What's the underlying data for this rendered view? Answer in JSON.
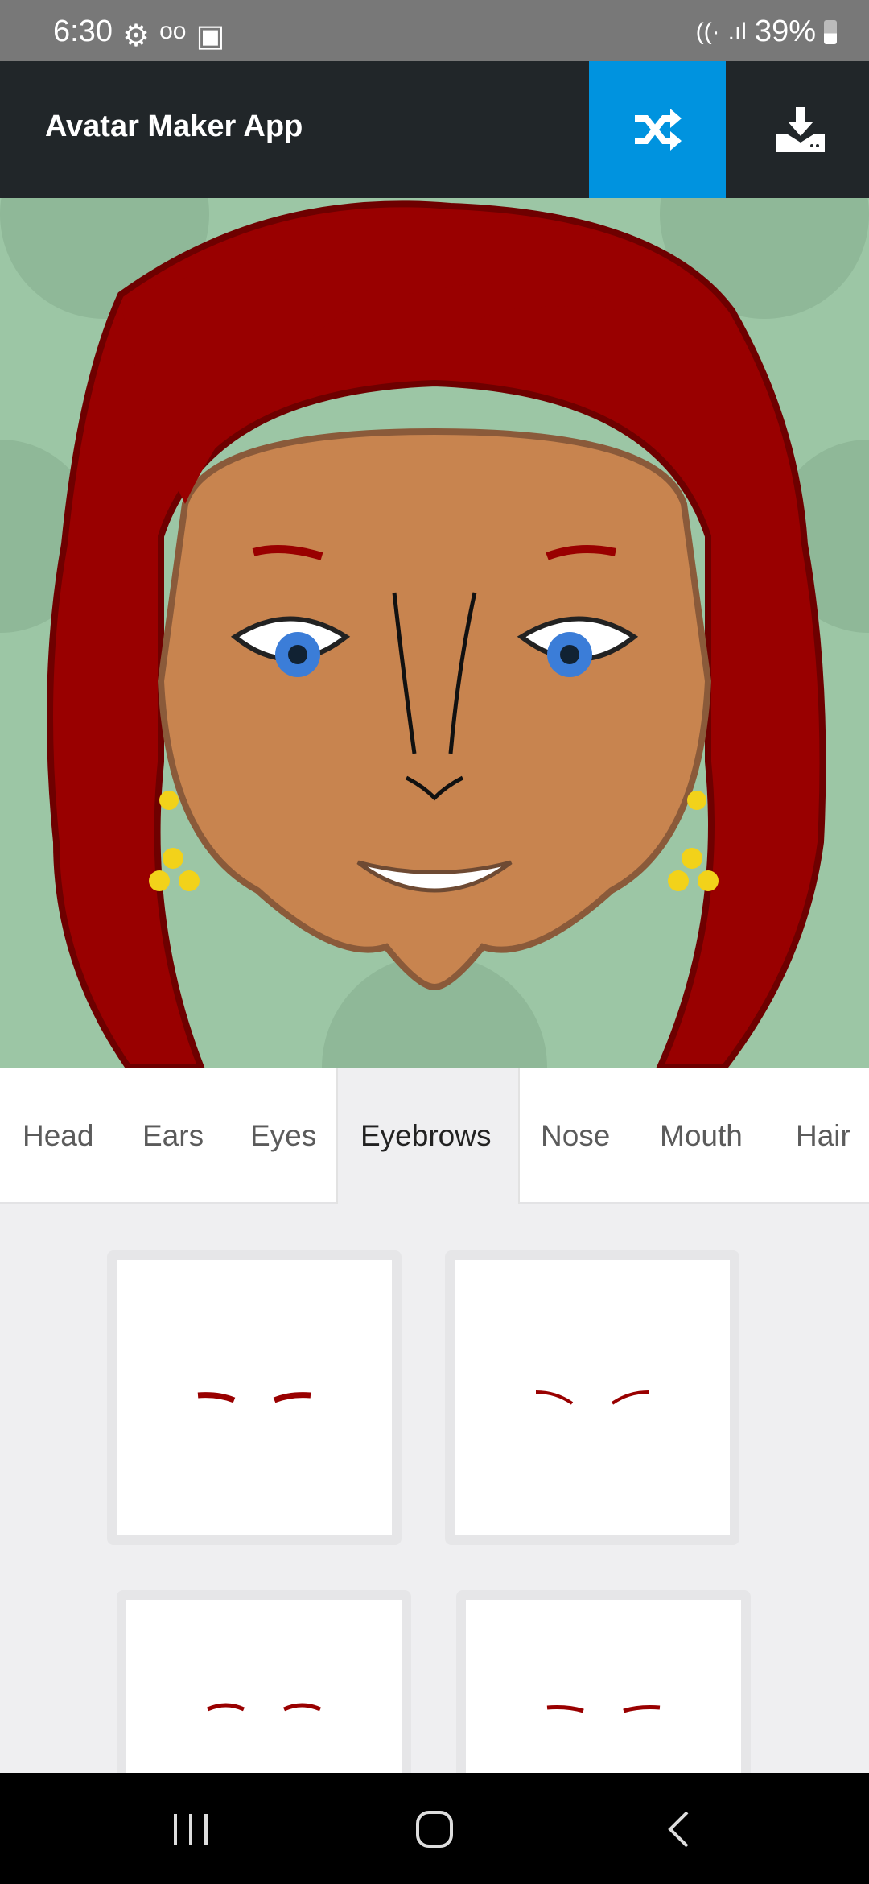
{
  "status_bar": {
    "time": "6:30",
    "battery": "39%"
  },
  "app_bar": {
    "title": "Avatar Maker App",
    "shuffle_icon": "shuffle-icon",
    "download_icon": "download-icon",
    "accent": "#0093df"
  },
  "tabs": [
    {
      "label": "Head"
    },
    {
      "label": "Ears"
    },
    {
      "label": "Eyes"
    },
    {
      "label": "Eyebrows",
      "active": true
    },
    {
      "label": "Nose"
    },
    {
      "label": "Mouth"
    },
    {
      "label": "Hair"
    }
  ],
  "eyebrow_options": [
    {
      "style": "flat"
    },
    {
      "style": "angled"
    },
    {
      "style": "arched"
    },
    {
      "style": "thin"
    }
  ],
  "colors": {
    "hair": "#990000",
    "skin": "#c8844f",
    "background": "#9cc6a5"
  }
}
